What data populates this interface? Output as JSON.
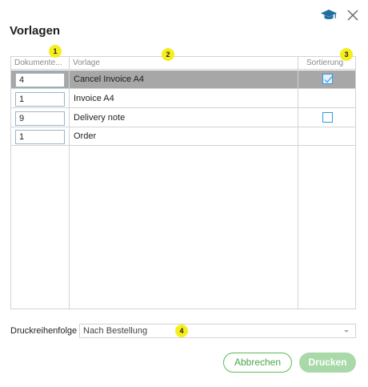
{
  "dialog": {
    "title": "Vorlagen",
    "icons": {
      "help": "graduation-cap-icon",
      "close": "close-icon"
    }
  },
  "table": {
    "columns": [
      {
        "label": "Dokumente...",
        "badge": "1"
      },
      {
        "label": "Vorlage",
        "badge": "2"
      },
      {
        "label": "Sortierung",
        "badge": "3"
      }
    ],
    "rows": [
      {
        "quantity": "4",
        "template": "Cancel Invoice A4",
        "checkbox": "checked",
        "selected": true
      },
      {
        "quantity": "1",
        "template": "Invoice A4",
        "checkbox": "none",
        "selected": false
      },
      {
        "quantity": "9",
        "template": "Delivery note",
        "checkbox": "unchecked",
        "selected": false
      },
      {
        "quantity": "1",
        "template": "Order",
        "checkbox": "none",
        "selected": false
      }
    ]
  },
  "print_order": {
    "label": "Druckreihenfolge",
    "value": "Nach Bestellung",
    "badge": "4"
  },
  "buttons": {
    "cancel": "Abbrechen",
    "print": "Drucken"
  },
  "colors": {
    "accent_green": "#5cb85c",
    "print_button_disabled": "#a9d9a9",
    "selected_row": "#a7a7a7",
    "checkbox_blue": "#2d9ae0",
    "annotation_badge": "#f6ee1c"
  }
}
